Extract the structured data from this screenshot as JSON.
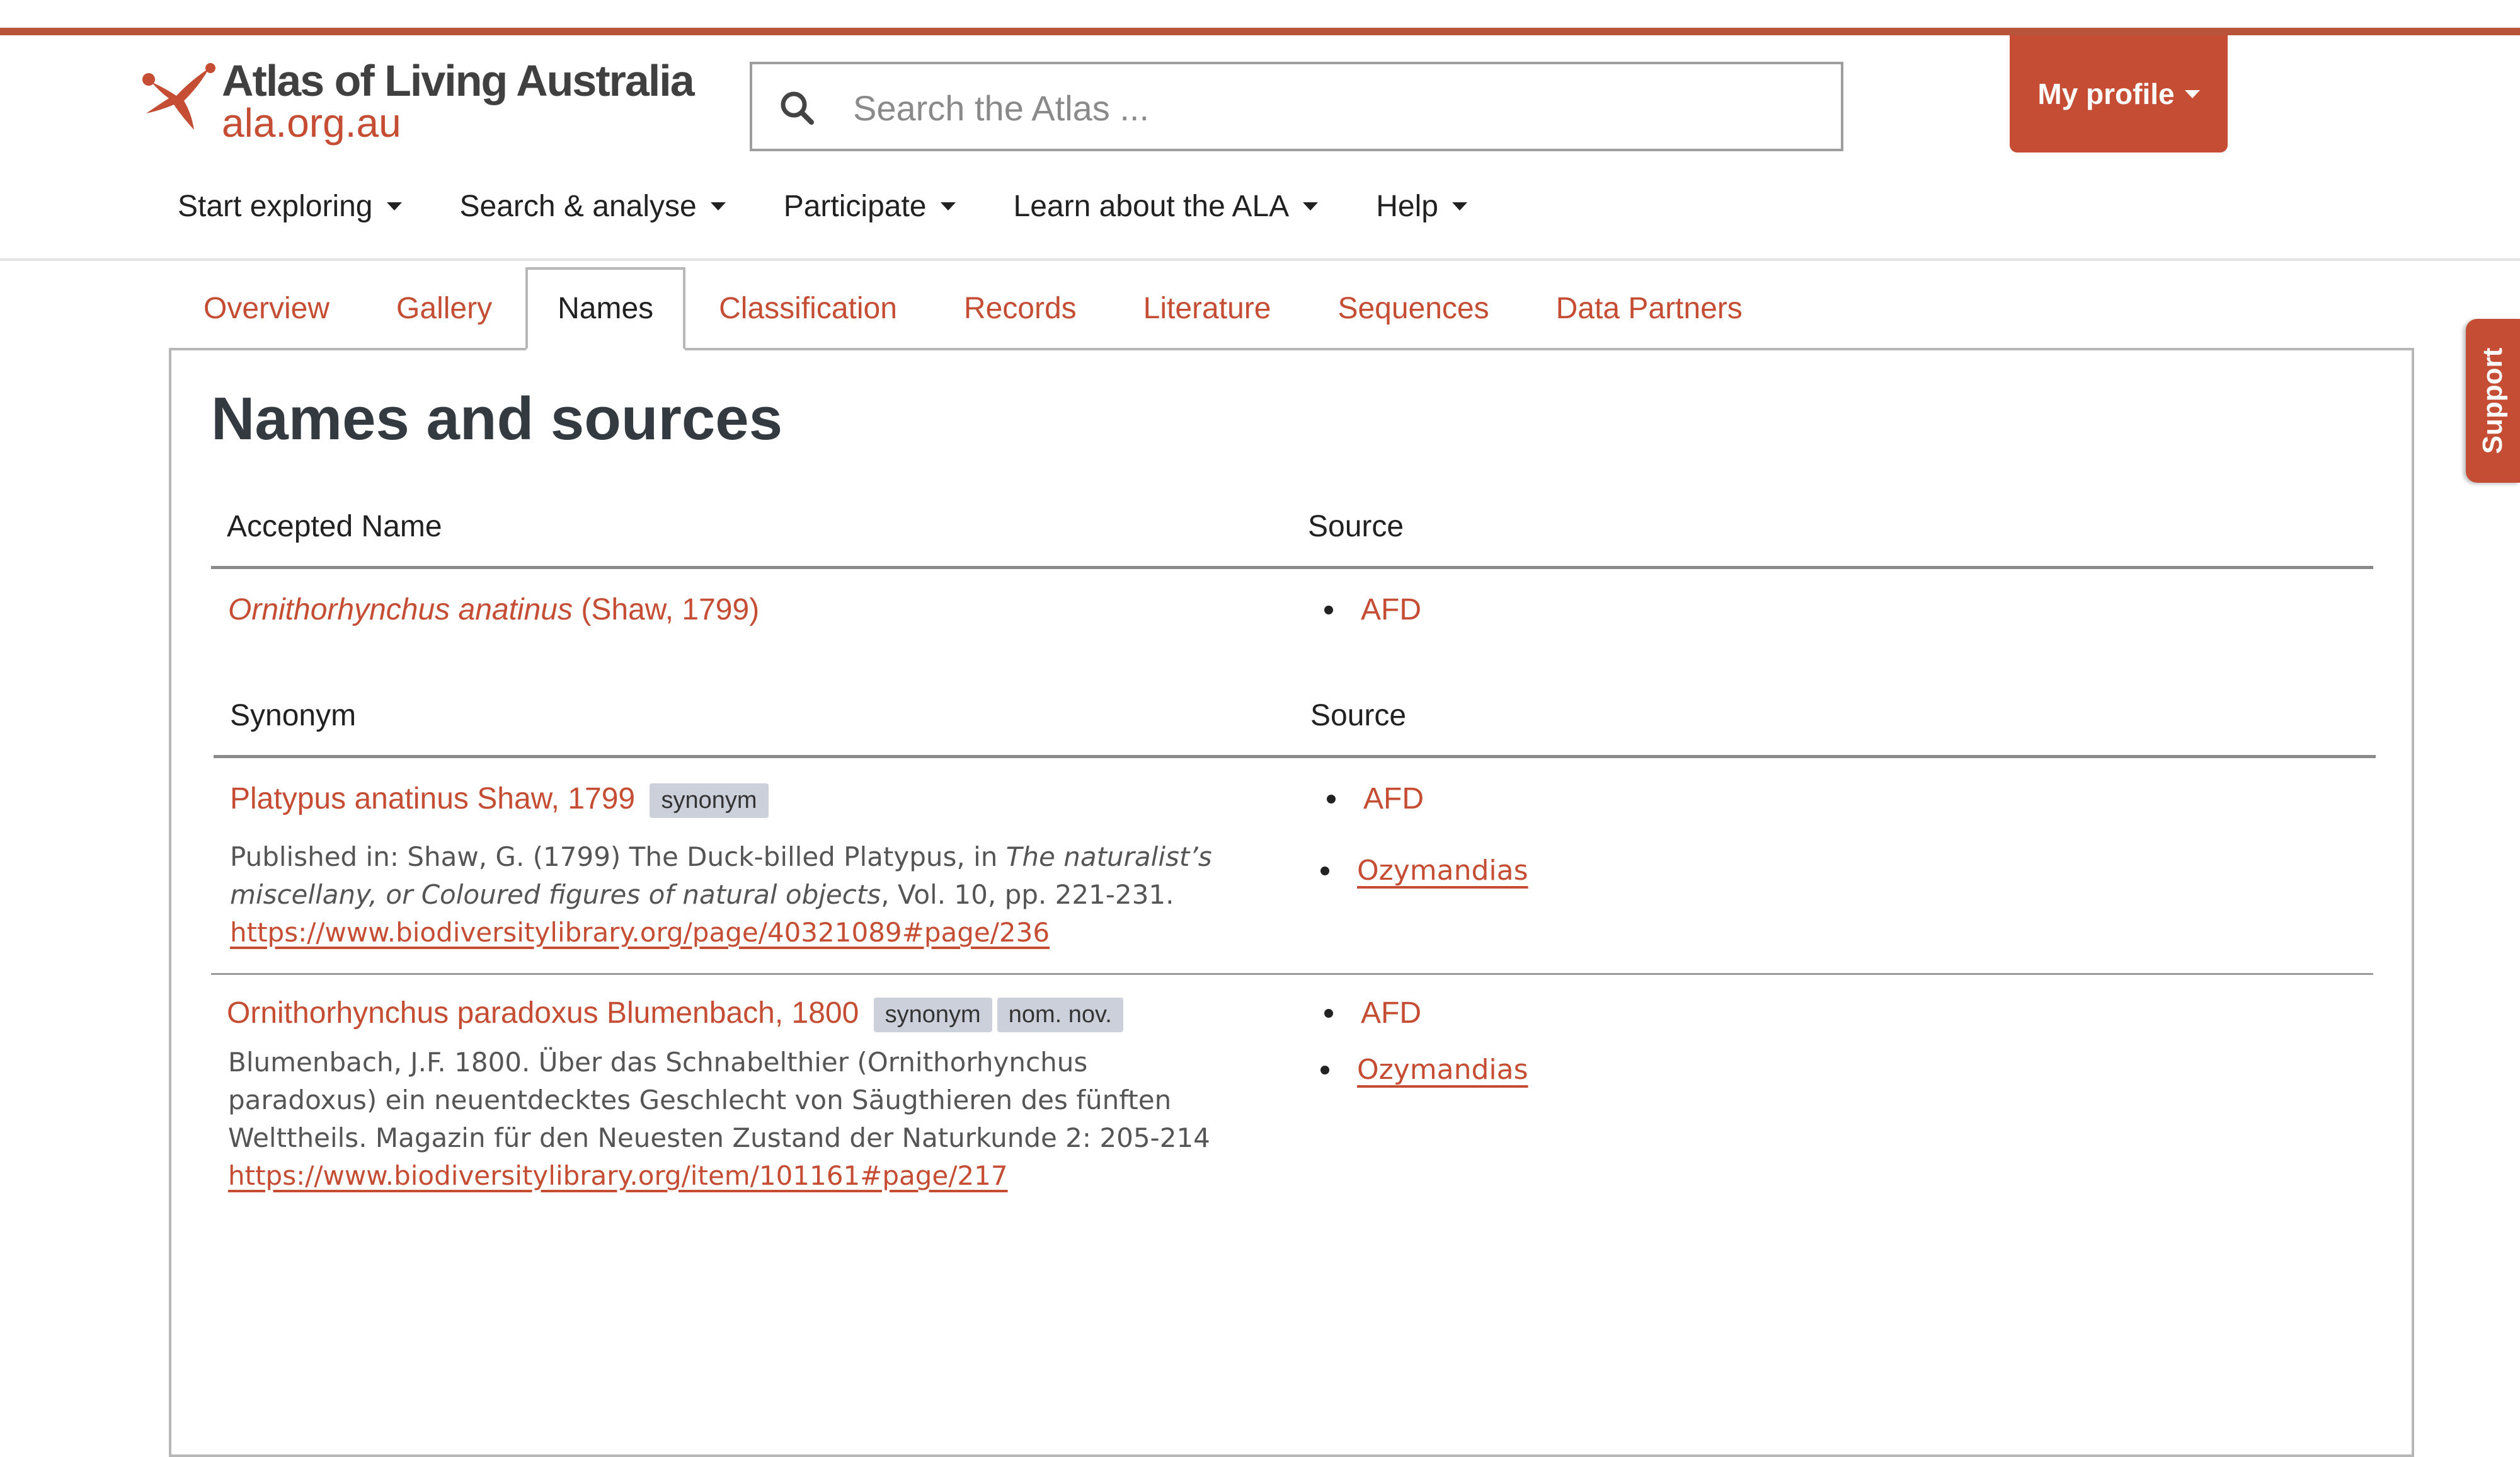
{
  "brand": {
    "name": "Atlas of Living Australia",
    "domain": "ala.org.au",
    "accent": "#c44d34"
  },
  "search": {
    "placeholder": "Search the Atlas ..."
  },
  "profile": {
    "label": "My profile"
  },
  "nav": [
    {
      "label": "Start exploring"
    },
    {
      "label": "Search & analyse"
    },
    {
      "label": "Participate"
    },
    {
      "label": "Learn about the ALA"
    },
    {
      "label": "Help"
    }
  ],
  "tabs": [
    {
      "label": "Overview"
    },
    {
      "label": "Gallery"
    },
    {
      "label": "Names",
      "active": true
    },
    {
      "label": "Classification"
    },
    {
      "label": "Records"
    },
    {
      "label": "Literature"
    },
    {
      "label": "Sequences"
    },
    {
      "label": "Data Partners"
    }
  ],
  "page": {
    "title": "Names and sources"
  },
  "accepted": {
    "col_name": "Accepted Name",
    "col_source": "Source",
    "name_italic": "Ornithorhynchus anatinus",
    "author": "(Shaw, 1799)",
    "sources": [
      "AFD"
    ]
  },
  "synonyms": {
    "col_name": "Synonym",
    "col_source": "Source",
    "rows": [
      {
        "name": "Platypus anatinus Shaw, 1799",
        "badges": [
          "synonym"
        ],
        "published": {
          "prefix": "Published in: Shaw, G. (1799) The Duck-billed Platypus, in ",
          "title": "The naturalist’s miscellany, or Coloured figures of natural objects",
          "suffix": ", Vol. 10, pp. 221-231.",
          "link": "https://www.biodiversitylibrary.org/page/40321089#page/236"
        },
        "sources": [
          "AFD",
          "Ozymandias"
        ]
      },
      {
        "name": "Ornithorhynchus paradoxus Blumenbach, 1800",
        "badges": [
          "synonym",
          "nom. nov."
        ],
        "published": {
          "text": "Blumenbach, J.F. 1800. Über das Schnabelthier (Ornithorhynchus paradoxus) ein neuentdecktes Geschlecht von Säugthieren des fünften Welttheils. Magazin für den Neuesten Zustand der Naturkunde 2: 205-214",
          "link": "https://www.biodiversitylibrary.org/item/101161#page/217"
        },
        "sources": [
          "AFD",
          "Ozymandias"
        ]
      }
    ]
  },
  "support": {
    "label": "Support"
  }
}
